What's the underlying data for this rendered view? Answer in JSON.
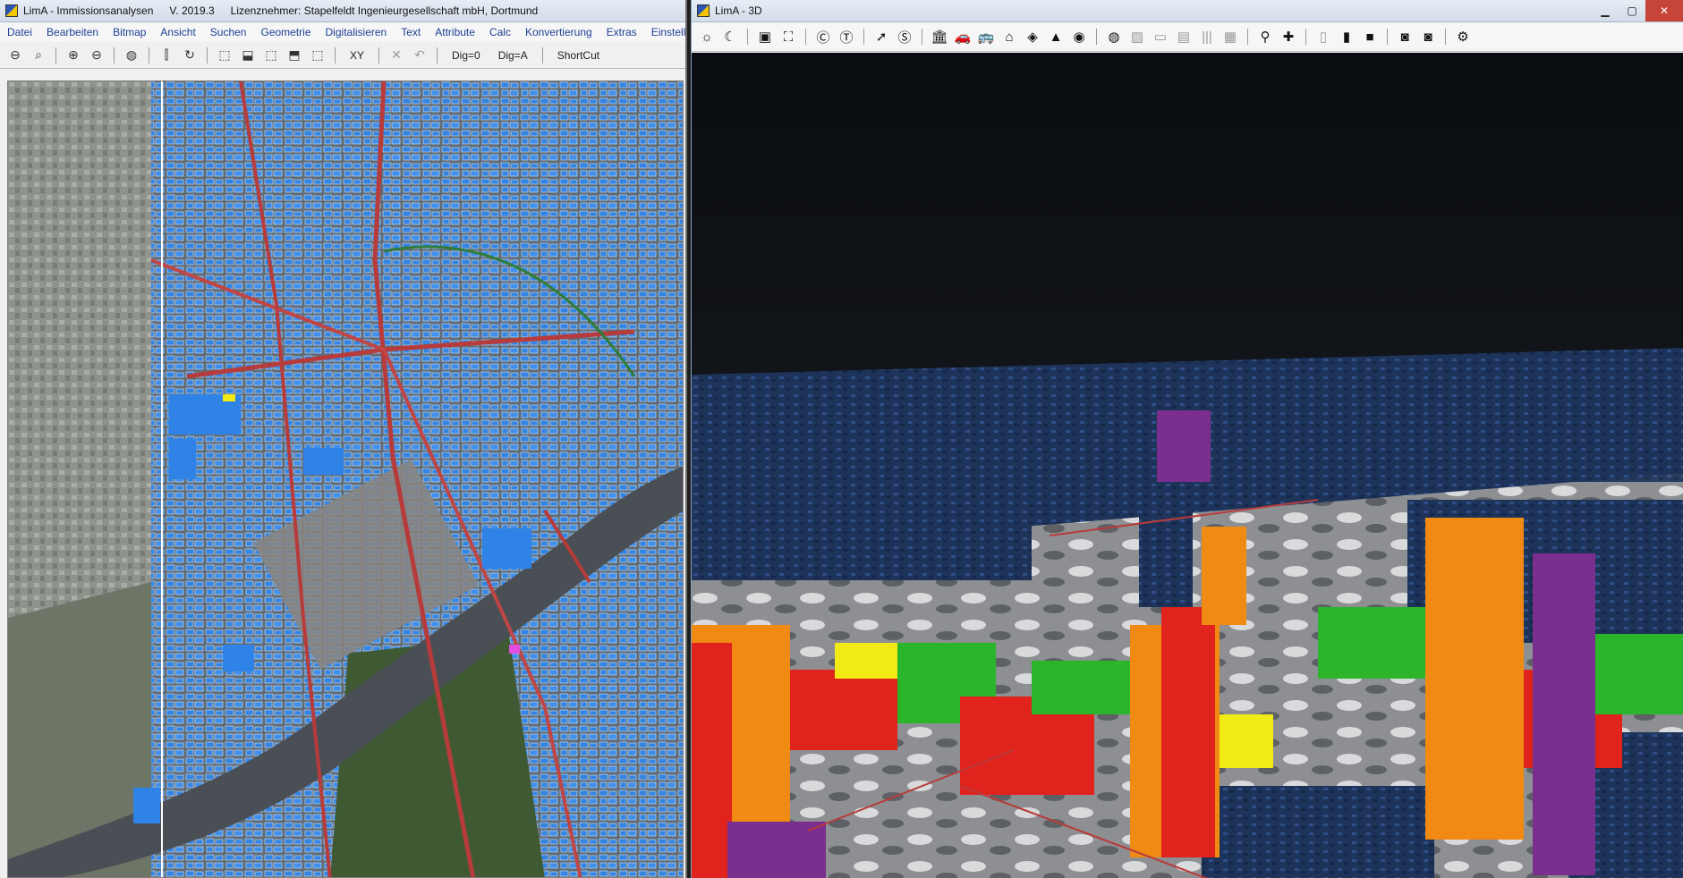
{
  "left_window": {
    "title": "LimA - Immissionsanalysen",
    "version": "V. 2019.3",
    "licensee": "Lizenznehmer: Stapelfeldt Ingenieurgesellschaft mbH, Dortmund",
    "menu": [
      "Datei",
      "Bearbeiten",
      "Bitmap",
      "Ansicht",
      "Suchen",
      "Geometrie",
      "Digitalisieren",
      "Text",
      "Attribute",
      "Calc",
      "Konvertierung",
      "Extras",
      "Einstellungen"
    ],
    "toolbar": {
      "xy_label": "XY",
      "dig0_label": "Dig=0",
      "diga_label": "Dig=A",
      "shortcut_label": "ShortCut"
    },
    "icons": [
      "zoom-out-icon",
      "zoom-icon",
      "zoom-in-icon",
      "zoom-minus-icon",
      "globe-icon",
      "chart-icon",
      "refresh-icon",
      "select-icon",
      "select-point-icon",
      "select-zoom-icon",
      "select-area-icon",
      "select-multi-icon",
      "delete-icon",
      "undo-icon"
    ]
  },
  "right_window": {
    "title": "LimA - 3D",
    "toolbar_icons": [
      "sun-icon",
      "moon-icon",
      "frame-icon",
      "frame-alt-icon",
      "c-icon",
      "t-icon",
      "cursor-icon",
      "s-icon",
      "building-icon",
      "car-icon",
      "bus-icon",
      "bank-icon",
      "pill-icon",
      "mountain-icon",
      "eye-icon",
      "globe-icon",
      "image-icon",
      "folder-icon",
      "panel-icon",
      "bars-icon",
      "grid-icon",
      "pin-icon",
      "plus-icon",
      "doc-icon",
      "doc-lock-icon",
      "lock-icon",
      "camera-icon",
      "camera-alt-icon",
      "gear-icon"
    ]
  },
  "colors": {
    "building_blue": "#2f83e6",
    "road_red": "#b83b3b",
    "river": "#4a4f55",
    "level_red": "#e0231c",
    "level_orange": "#f08a12",
    "level_yellow": "#f2ea15",
    "level_green": "#2bb52b",
    "level_purple": "#7a2f8f",
    "roof_navy": "#1d3359",
    "sky": "#0a0d12"
  }
}
